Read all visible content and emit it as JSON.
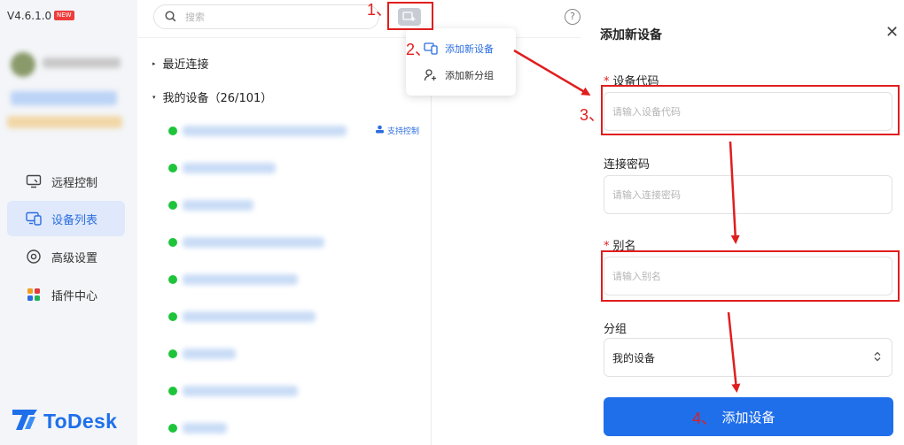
{
  "app": {
    "version": "V4.6.1.0",
    "new_badge": "NEW",
    "logo_text": "ToDesk"
  },
  "sidebar": {
    "items": [
      {
        "label": "远程控制",
        "icon": "monitor-icon",
        "active": false
      },
      {
        "label": "设备列表",
        "icon": "devices-icon",
        "active": true
      },
      {
        "label": "高级设置",
        "icon": "gear-icon",
        "active": false
      },
      {
        "label": "插件中心",
        "icon": "plugins-icon",
        "active": false
      }
    ]
  },
  "search": {
    "placeholder": "搜索"
  },
  "help_glyph": "?",
  "device_list": {
    "recent_label": "最近连接",
    "my_devices_label": "我的设备（26/101）",
    "support_label": "支持控制"
  },
  "popup_menu": {
    "items": [
      {
        "label": "添加新设备",
        "icon": "add-device-icon"
      },
      {
        "label": "添加新分组",
        "icon": "add-group-icon"
      }
    ]
  },
  "annotations": {
    "step1": "1、",
    "step2": "2、",
    "step3": "3、",
    "step4": "4、"
  },
  "dialog": {
    "title": "添加新设备",
    "close_glyph": "✕",
    "device_code_label": "设备代码",
    "device_code_placeholder": "请输入设备代码",
    "password_label": "连接密码",
    "password_placeholder": "请输入连接密码",
    "alias_label": "别名",
    "alias_placeholder": "请输入别名",
    "group_label": "分组",
    "group_value": "我的设备",
    "required_mark": "*",
    "submit_label": "添加设备"
  },
  "colors": {
    "accent": "#1f6feb",
    "annotation": "#e01e1e",
    "online": "#1ec43a"
  }
}
